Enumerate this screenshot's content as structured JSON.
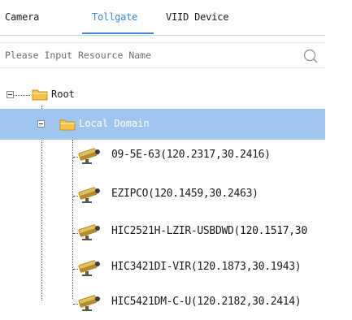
{
  "tabs": [
    {
      "label": "Camera",
      "active": false
    },
    {
      "label": "Tollgate",
      "active": true
    },
    {
      "label": "VIID Device",
      "active": false
    }
  ],
  "search": {
    "placeholder": "Please Input Resource Name",
    "value": ""
  },
  "tree": {
    "root": {
      "label": "Root",
      "expanded": true
    },
    "domain": {
      "label": "Local Domain",
      "expanded": true,
      "selected": true
    },
    "cameras": [
      {
        "label": "09-5E-63(120.2317,30.2416)"
      },
      {
        "label": "EZIPCO(120.1459,30.2463)"
      },
      {
        "label": "HIC2521H-LZIR-USBDWD(120.1517,30"
      },
      {
        "label": "HIC3421DI-VIR(120.1873,30.1943)"
      },
      {
        "label": "HIC5421DM-C-U(120.2182,30.2414)"
      }
    ]
  },
  "colors": {
    "accent": "#3a86d6",
    "selection": "#9fc6ee",
    "folder": "#f5c24a",
    "camera": "#c8a43a"
  },
  "icons": {
    "search": "search-icon",
    "folder": "folder-icon",
    "camera": "camera-icon",
    "expander": "collapse-icon"
  }
}
